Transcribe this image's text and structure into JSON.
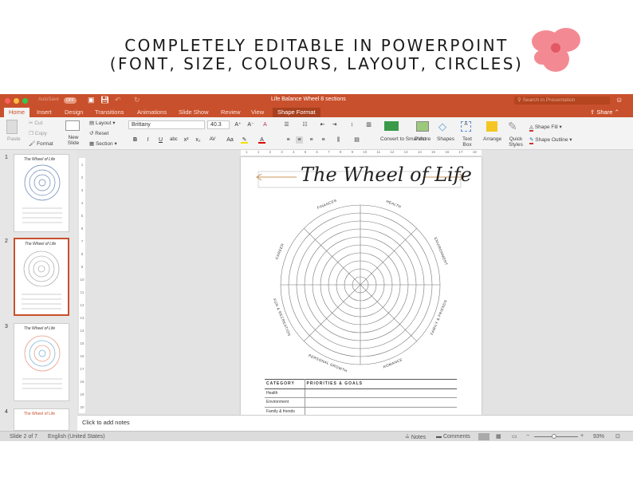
{
  "promo": {
    "line1": "COMPLETELY EDITABLE IN POWERPOINT",
    "line2": "(FONT, SIZE, COLOURS, LAYOUT, CIRCLES)"
  },
  "window": {
    "autosave": "AutoSave",
    "autosave_state": "OFF",
    "title": "Life Balance Wheel 8 sections",
    "search_placeholder": "Search in Presentation",
    "share": "Share"
  },
  "tabs": [
    "Home",
    "Insert",
    "Design",
    "Transitions",
    "Animations",
    "Slide Show",
    "Review",
    "View",
    "Shape Format"
  ],
  "ribbon": {
    "paste": "Paste",
    "cut": "Cut",
    "copy": "Copy",
    "format": "Format",
    "new_slide": "New Slide",
    "layout": "Layout",
    "reset": "Reset",
    "section": "Section",
    "font": "Brittany",
    "size": "40.3",
    "convert": "Convert to SmartArt",
    "picture": "Picture",
    "shapes": "Shapes",
    "text_box": "Text Box",
    "arrange": "Arrange",
    "quick_styles": "Quick Styles",
    "shape_fill": "Shape Fill",
    "shape_outline": "Shape Outline"
  },
  "ruler": [
    "1",
    "1",
    "2",
    "3",
    "4",
    "5",
    "6",
    "7",
    "8",
    "9",
    "10",
    "11",
    "12",
    "13",
    "14",
    "15",
    "16",
    "17",
    "18"
  ],
  "vruler": [
    "1",
    "2",
    "3",
    "4",
    "5",
    "6",
    "7",
    "8",
    "9",
    "10",
    "11",
    "12",
    "13",
    "14",
    "15",
    "16",
    "17",
    "18",
    "19",
    "20"
  ],
  "thumbnails": [
    {
      "num": "1",
      "title": "The Wheel of Life"
    },
    {
      "num": "2",
      "title": "The Wheel of Life"
    },
    {
      "num": "3",
      "title": "The Wheel of Life"
    },
    {
      "num": "4",
      "title": "The Wheel of Life"
    }
  ],
  "slide": {
    "title": "The Wheel of Life",
    "sections": [
      "FINANCES",
      "HEALTH",
      "ENVIRONMENT",
      "FAMILY & FRIENDS",
      "ROMANCE",
      "PERSONAL GROWTH",
      "FUN & RECREATION",
      "CAREER"
    ],
    "table_headers": [
      "CATEGORY",
      "PRIORITIES & GOALS"
    ],
    "table_rows": [
      "Health",
      "Environment",
      "Family & friends"
    ]
  },
  "notes_placeholder": "Click to add notes",
  "status": {
    "slide": "Slide 2 of 7",
    "language": "English (United States)",
    "notes": "Notes",
    "comments": "Comments",
    "zoom": "93%"
  },
  "colors": {
    "accent": "#c9502c",
    "arrow": "#c8935a"
  }
}
